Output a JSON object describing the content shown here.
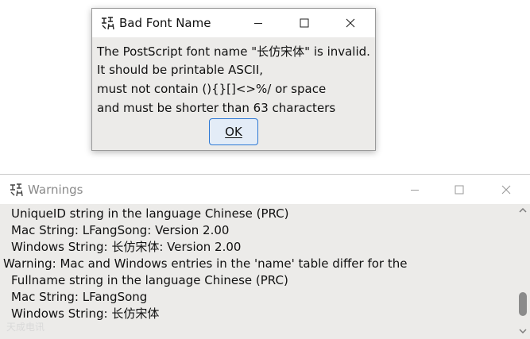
{
  "warnings_window": {
    "title": "Warnings",
    "lines": [
      {
        "text": "UniqueID string in the language Chinese (PRC)",
        "indent": true
      },
      {
        "text": "Mac String: LFangSong: Version 2.00",
        "indent": true
      },
      {
        "text": "Windows String: 长仿宋体: Version 2.00",
        "indent": true
      },
      {
        "text": "Warning: Mac and Windows entries in the 'name' table differ for the",
        "indent": false
      },
      {
        "text": "Fullname string in the language Chinese (PRC)",
        "indent": true
      },
      {
        "text": "Mac String: LFangSong",
        "indent": true
      },
      {
        "text": "Windows String: 长仿宋体",
        "indent": true
      }
    ],
    "scroll_position": 0.9
  },
  "dialog": {
    "title": "Bad Font Name",
    "message_lines": [
      "The PostScript font name \"长仿宋体\" is invalid.",
      "It should be printable ASCII,",
      "must not contain (){}[]<>%/ or space",
      "and must be shorter than 63 characters"
    ],
    "ok_label": "OK"
  },
  "watermark": "天成电讯",
  "colors": {
    "content_bg": "#ecebe9",
    "titlebar_bg": "#ffffff",
    "accent_border": "#2d78d4",
    "inactive_title_text": "#8a8a8a"
  }
}
